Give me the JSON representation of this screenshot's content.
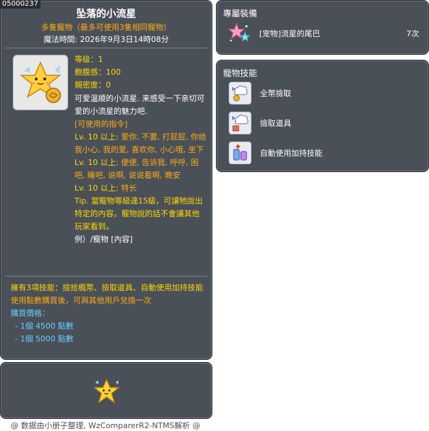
{
  "item": {
    "id": "05000237",
    "name": "坠落的小流星",
    "subtitle": "多隻寵物（最多可使用3隻相同寵物）",
    "expire_label": "魔法時間:",
    "expire_value": "2026年9月3日14時08分",
    "icon": "falling-star-pet-icon"
  },
  "stats": {
    "level": "等级：1",
    "fullness": "飽腹感：100",
    "closeness": "親密度：0"
  },
  "description": {
    "intro": "可爱温顺的小流星. 来感受一下亲切可爱的小流星的魅力吧.",
    "commands_header": "[可使用的指令]",
    "command1_level": "Lv. 10 以上:",
    "command1_words": "爱你, 不要, 打屁屁, 你给我小心, 我的爱, 喜欢你, 小心哦, 坐下",
    "command2_level": "Lv. 10 以上:",
    "command2_words": "便便, 告诉我, 呼呼, 困吧, 睡吧, 说啊, 说说看啊, 晚安",
    "command3_level": "Lv. 10 以上:",
    "command3_words": "特长",
    "tip": "Tip. 當寵物等級達15級，可讓牠說出特定的內容。寵物說的話不會讓其他玩家看到。",
    "example": "例）/寵物 [內容]"
  },
  "bottom": {
    "skills_text": "擁有3項技能：撿拾楓幣、撿取道具、自動使用加持技能",
    "trade_text": "使用點數購買後，可與其他用戶兌換一次",
    "price_header": "購買價格：",
    "price_1": "- 1個 4500 點數",
    "price_2": "- 1個 5000 點數"
  },
  "equip": {
    "title": "專屬裝備",
    "item_name": "[宠物]流星的尾巴",
    "item_count": "7次",
    "icon": "star-tail-icon"
  },
  "pet_skills": {
    "title": "寵物技能",
    "items": [
      {
        "label": "全幣撿取",
        "icon": "pickup-meso-icon"
      },
      {
        "label": "撿取道具",
        "icon": "pickup-item-icon"
      },
      {
        "label": "自動使用加持技能",
        "icon": "auto-buff-icon"
      }
    ]
  },
  "footer": "@ 数据由小册子整理, WzComparerR2-NTMS解析 @",
  "colors": {
    "panel_bg": "#4a5058",
    "orange": "#ffaa11",
    "yellow": "#ffd700",
    "blue": "#66ccff"
  }
}
